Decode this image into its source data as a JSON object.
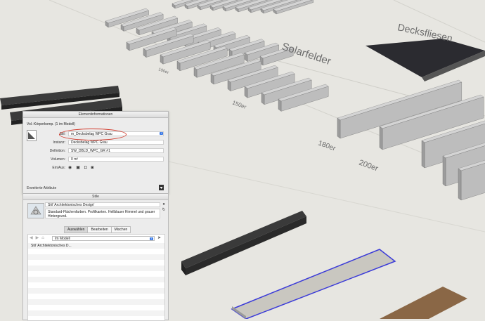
{
  "viewport": {
    "labels": {
      "decksfliesen": "Decksfliesen",
      "solarfelder": "Solarfelder",
      "size_100": "100er",
      "size_150": "150er",
      "size_180": "180er",
      "size_200": "200er"
    },
    "colors": {
      "background": "#e7e6e1",
      "beam_light": "#bdbdbd",
      "beam_dark": "#2c2c2c",
      "selection": "#3b3bd8",
      "wood": "#8a6746"
    }
  },
  "entity_info": {
    "title": "Elementinformationen",
    "type_label": "Vol.-Körperkomp. (1 im Modell)",
    "fields": [
      {
        "label": "Stil:",
        "value": "m_Decksbelag WPC Grau"
      },
      {
        "label": "Instanz:",
        "value": "Decksbelag WPC Grau"
      },
      {
        "label": "Definition:",
        "value": "SW_DBLD_WPC_GR #1"
      },
      {
        "label": "Volumen:",
        "value": "0 m³"
      }
    ],
    "toggle_label": "Ein/Aus:",
    "toggle_icons": [
      "eye-icon",
      "lock-icon",
      "shadow-cast-icon",
      "shadow-receive-icon"
    ],
    "advanced_label": "Erweiterte Attribute",
    "highlight_color": "#d23a2c"
  },
  "styles": {
    "title": "Stile",
    "name": "Stil 'Architektonisches Design'",
    "description": "Standard-Flächenfarben. Profilkanten. Hellblauer Himmel und grauer Hintergrund.",
    "tabs": [
      {
        "label": "Auswählen",
        "active": true
      },
      {
        "label": "Bearbeiten",
        "active": false
      },
      {
        "label": "Mischen",
        "active": false
      }
    ],
    "dropdown_value": "Im Modell",
    "list": [
      "Stil 'Architektonisches D..."
    ]
  }
}
